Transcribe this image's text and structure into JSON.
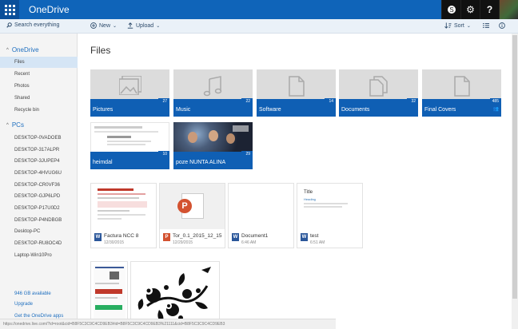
{
  "app": {
    "title": "OneDrive"
  },
  "topbar": {
    "skype_label": "S",
    "settings_label": "⚙",
    "help_label": "?"
  },
  "commandbar": {
    "search_label": "Search everything",
    "new_label": "New",
    "upload_label": "Upload",
    "sort_label": "Sort"
  },
  "sidebar": {
    "onedrive_heading": "OneDrive",
    "onedrive_items": [
      "Files",
      "Recent",
      "Photos",
      "Shared",
      "Recycle bin"
    ],
    "pcs_heading": "PCs",
    "pc_items": [
      "DESKTOP-0VADOEB",
      "DESKTOP-317ALPR",
      "DESKTOP-3JUPEP4",
      "DESKTOP-4HVUG6U",
      "DESKTOP-CR0VF36",
      "DESKTOP-GJP6LPD",
      "DESKTOP-P17U0D2",
      "DESKTOP-P4NDBGB",
      "Desktop-PC",
      "DESKTOP-RU8OC4D",
      "Laptop-Win10Pro"
    ],
    "storage_text": "946 GB available",
    "upgrade_label": "Upgrade",
    "apps_label": "Get the OneDrive apps"
  },
  "main": {
    "title": "Files",
    "folders": [
      {
        "name": "Pictures",
        "count": "27",
        "icon": "picture-icon"
      },
      {
        "name": "Music",
        "count": "22",
        "icon": "music-icon"
      },
      {
        "name": "Software",
        "count": "14",
        "icon": "document-icon"
      },
      {
        "name": "Documents",
        "count": "32",
        "icon": "documents-icon"
      },
      {
        "name": "Final Covers",
        "count": "485",
        "icon": "document-icon"
      },
      {
        "name": "heimdal",
        "count": "10"
      },
      {
        "name": "poze NUNTA ALINA",
        "count": "29"
      }
    ],
    "files": [
      {
        "name": "Factura NCC 8",
        "date": "12/30/2015",
        "type": "word"
      },
      {
        "name": "Tor_0.1_2015_12_15",
        "date": "12/29/2015",
        "type": "powerpoint"
      },
      {
        "name": "Document1",
        "date": "6:46 AM",
        "type": "word"
      },
      {
        "name": "test",
        "date": "6:51 AM",
        "type": "word"
      }
    ],
    "test_preview_title": "Title",
    "test_preview_heading": "Heading"
  },
  "status": {
    "url": "https://onedrive.live.com/?id=root&cid=B8F5C3C9C4CD9EB3#id=B8F5C3C9C4CD9EB3%21111&cid=B8F5C3C9C4CD9EB3"
  },
  "colors": {
    "accent": "#0f64b9",
    "folder_bar": "#0f5fb4",
    "selected": "#d5e5f5"
  }
}
